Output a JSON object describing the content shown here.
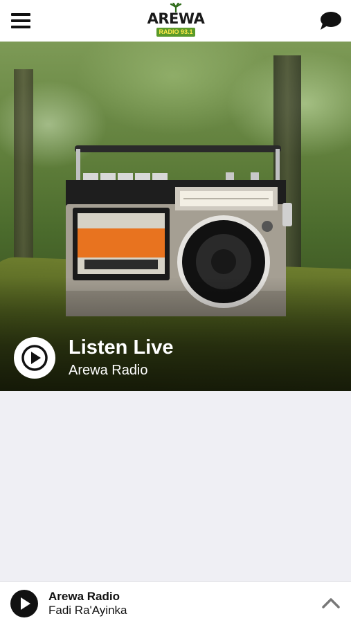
{
  "header": {
    "menu_icon": "hamburger-menu-icon",
    "logo": {
      "main_text": "AREWA",
      "sub_text": "RADIO 93.1",
      "accent": "#5a9a2a"
    },
    "chat_icon": "chat-bubble-icon"
  },
  "hero": {
    "title": "Listen Live",
    "subtitle": "Arewa Radio",
    "play_icon": "play-icon",
    "image_subject": "vintage-radio-cassette-player"
  },
  "now_playing": {
    "station": "Arewa Radio",
    "show": "Fadi Ra'Ayinka",
    "play_icon": "play-icon",
    "expand_icon": "chevron-up-icon"
  },
  "colors": {
    "background": "#efeff4",
    "bar": "#ffffff",
    "text": "#111111"
  }
}
